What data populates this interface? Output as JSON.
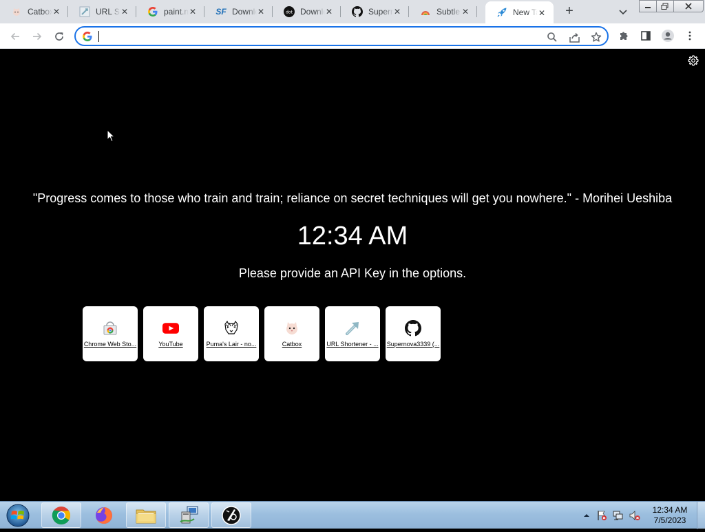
{
  "browser": {
    "tabs": [
      {
        "title": "Catbox",
        "favicon": "cat-favicon"
      },
      {
        "title": "URL Shortener",
        "favicon": "url-shortener-favicon"
      },
      {
        "title": "paint.net",
        "favicon": "google-favicon"
      },
      {
        "title": "Download",
        "favicon": "sourceforge-favicon"
      },
      {
        "title": "Download",
        "favicon": "dotnet-favicon"
      },
      {
        "title": "Supernova",
        "favicon": "github-favicon"
      },
      {
        "title": "Subtle",
        "favicon": "subtle-favicon"
      },
      {
        "title": "New Tab",
        "favicon": "rocket-favicon",
        "active": true
      }
    ],
    "new_tab_symbol": "+",
    "omnibox": {
      "value": "",
      "placeholder": ""
    }
  },
  "page": {
    "quote": "\"Progress comes to those who train and train; reliance on secret techniques will get you nowhere.\" - Morihei Ueshiba",
    "time": "12:34 AM",
    "notice": "Please provide an API Key in the options.",
    "shortcuts": [
      {
        "label": "Chrome Web Sto...",
        "icon": "chrome-web-store-icon"
      },
      {
        "label": "YouTube",
        "icon": "youtube-icon"
      },
      {
        "label": "Puma's Lair - no...",
        "icon": "puma-icon"
      },
      {
        "label": "Catbox",
        "icon": "catbox-icon"
      },
      {
        "label": "URL Shortener - ...",
        "icon": "url-shortener-icon"
      },
      {
        "label": "Supernova3339 (...",
        "icon": "github-icon"
      }
    ]
  },
  "taskbar": {
    "apps": [
      "chrome-icon",
      "firefox-icon",
      "file-explorer-icon",
      "network-app-icon",
      "inkscape-icon"
    ],
    "clock": {
      "time": "12:34 AM",
      "date": "7/5/2023"
    }
  },
  "colors": {
    "accent": "#1a73e8",
    "tabstrip": "#dee1e6",
    "page_bg": "#000000",
    "taskbar": "#9cbfdf"
  }
}
